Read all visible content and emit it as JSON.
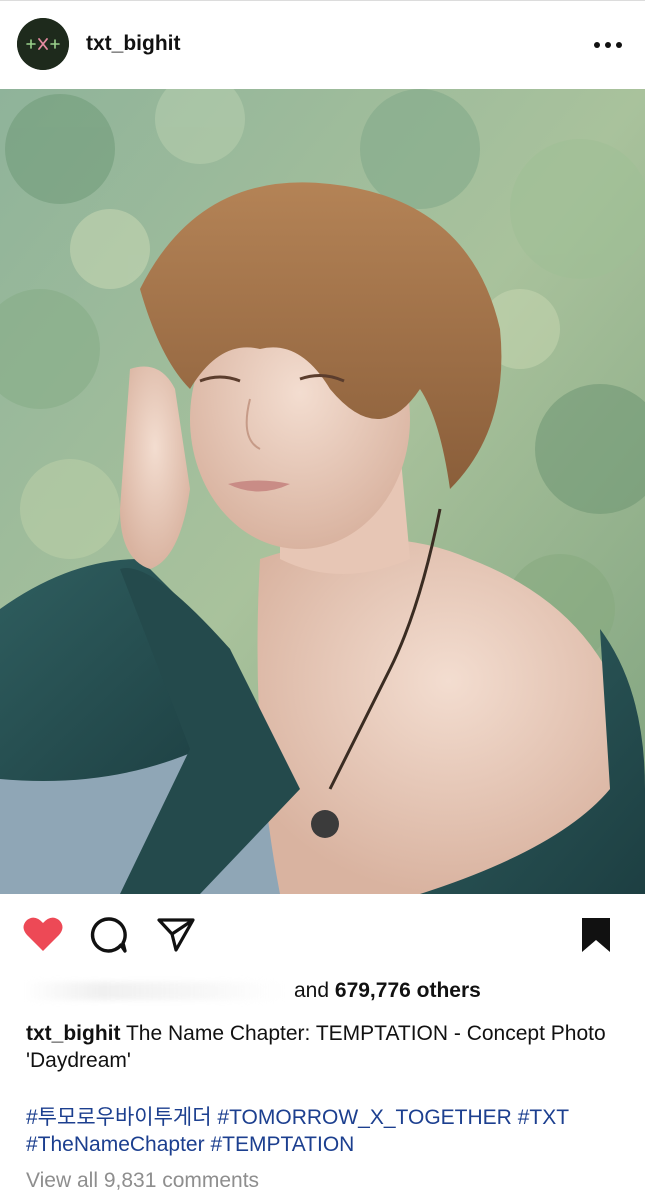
{
  "post": {
    "username": "txt_bighit",
    "more_icon": "ellipsis-icon",
    "avatar_icon": "txt-logo-icon"
  },
  "actions": {
    "like_icon": "heart-filled-icon",
    "comment_icon": "comment-icon",
    "share_icon": "send-icon",
    "save_icon": "bookmark-filled-icon",
    "like_color": "#ed4956"
  },
  "likes": {
    "prefix": "and",
    "count": "679,776 others"
  },
  "caption": {
    "username": "txt_bighit",
    "text": "The Name Chapter: TEMPTATION - Concept Photo 'Daydream'"
  },
  "hashtags": [
    "#투모로우바이투게더",
    "#TOMORROW_X_TOGETHER",
    "#TXT",
    "#TheNameChapter",
    "#TEMPTATION"
  ],
  "comments": {
    "label": "View all 9,831 comments"
  },
  "colors": {
    "hashtag": "#1c3f8f",
    "secondary_text": "#8e8e8e"
  }
}
